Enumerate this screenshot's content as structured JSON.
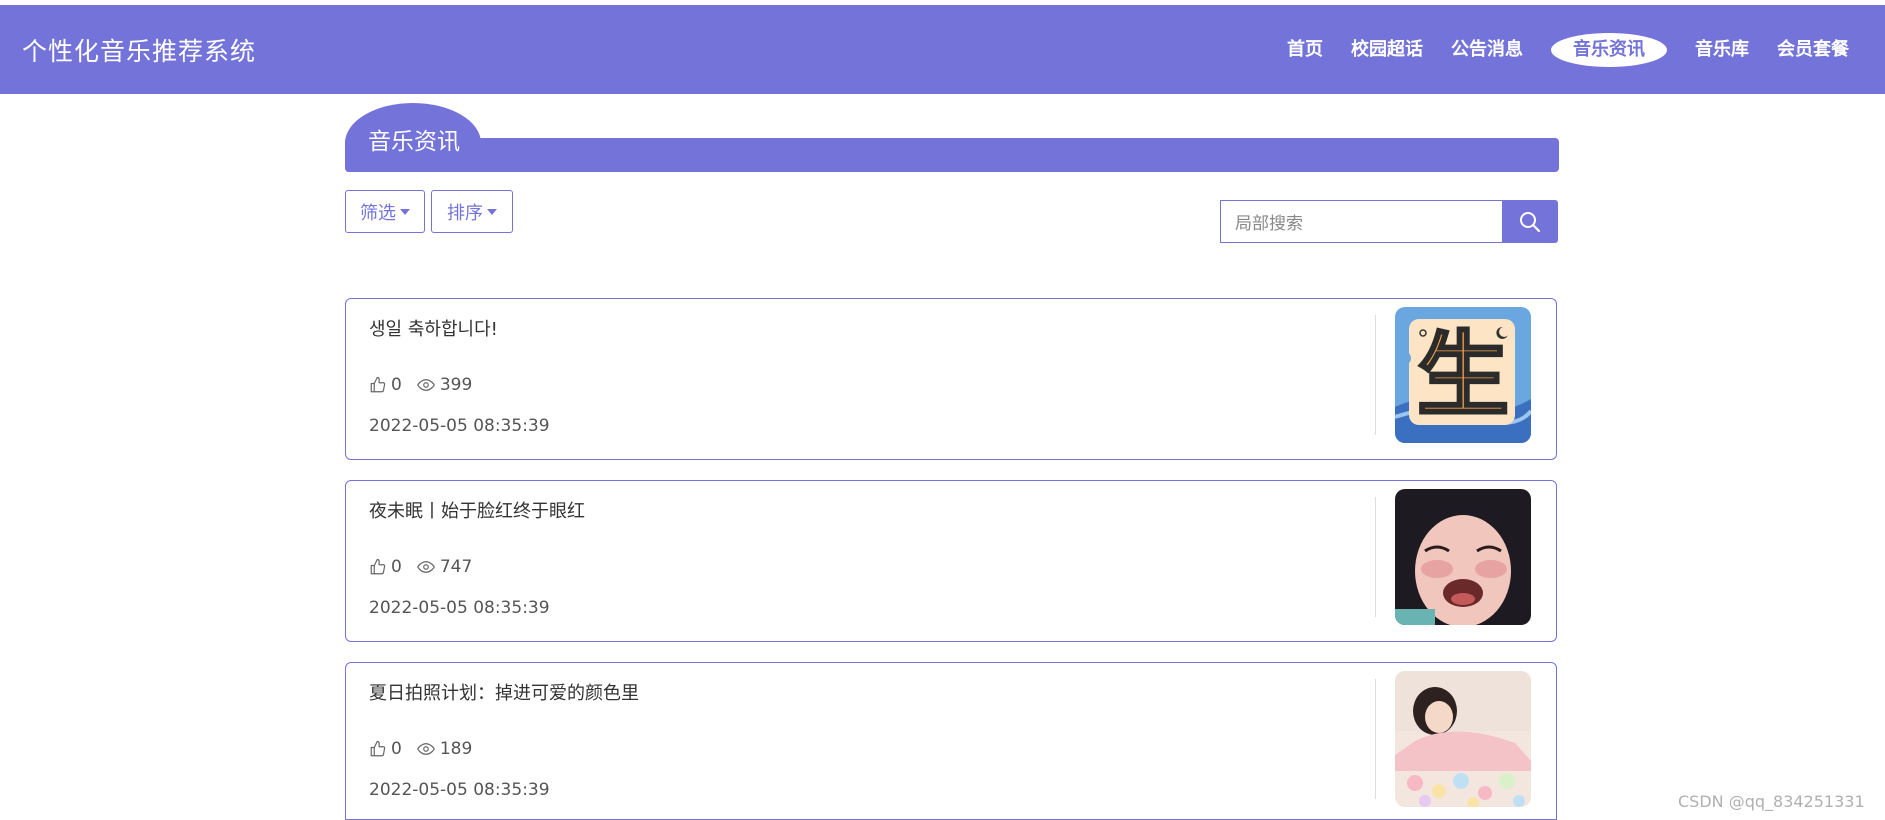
{
  "header": {
    "brand": "个性化音乐推荐系统",
    "nav": [
      {
        "label": "首页"
      },
      {
        "label": "校园超话"
      },
      {
        "label": "公告消息"
      },
      {
        "label": "音乐资讯"
      },
      {
        "label": "音乐库"
      },
      {
        "label": "会员套餐"
      }
    ],
    "active_index": 3
  },
  "section": {
    "title": "音乐资讯"
  },
  "toolbar": {
    "filter_label": "筛选",
    "sort_label": "排序",
    "search_placeholder": "局部搜索"
  },
  "articles": [
    {
      "title": "생일 축하합니다!",
      "likes": "0",
      "views": "399",
      "date": "2022-05-05 08:35:39"
    },
    {
      "title": "夜未眠丨始于脸红终于眼红",
      "likes": "0",
      "views": "747",
      "date": "2022-05-05 08:35:39"
    },
    {
      "title": "夏日拍照计划：掉进可爱的颜色里",
      "likes": "0",
      "views": "189",
      "date": "2022-05-05 08:35:39"
    }
  ],
  "watermark": "CSDN @qq_834251331",
  "colors": {
    "accent": "#7373d9",
    "header_text": "#ffffff"
  }
}
